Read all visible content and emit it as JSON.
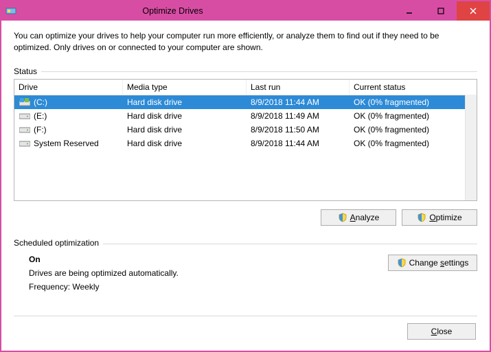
{
  "window": {
    "title": "Optimize Drives"
  },
  "intro": "You can optimize your drives to help your computer run more efficiently, or analyze them to find out if they need to be optimized. Only drives on or connected to your computer are shown.",
  "status_label": "Status",
  "columns": {
    "drive": "Drive",
    "media": "Media type",
    "last": "Last run",
    "status": "Current status"
  },
  "drives": [
    {
      "name": "(C:)",
      "media": "Hard disk drive",
      "last": "8/9/2018 11:44 AM",
      "status": "OK (0% fragmented)",
      "icon": "os-drive",
      "selected": true
    },
    {
      "name": "(E:)",
      "media": "Hard disk drive",
      "last": "8/9/2018 11:49 AM",
      "status": "OK (0% fragmented)",
      "icon": "hdd",
      "selected": false
    },
    {
      "name": "(F:)",
      "media": "Hard disk drive",
      "last": "8/9/2018 11:50 AM",
      "status": "OK (0% fragmented)",
      "icon": "hdd",
      "selected": false
    },
    {
      "name": "System Reserved",
      "media": "Hard disk drive",
      "last": "8/9/2018 11:44 AM",
      "status": "OK (0% fragmented)",
      "icon": "hdd",
      "selected": false
    }
  ],
  "buttons": {
    "analyze_pre": "",
    "analyze_u": "A",
    "analyze_post": "nalyze",
    "optimize_pre": "",
    "optimize_u": "O",
    "optimize_post": "ptimize",
    "change_pre": "Change ",
    "change_u": "s",
    "change_post": "ettings",
    "close_pre": "",
    "close_u": "C",
    "close_post": "lose"
  },
  "sched": {
    "label": "Scheduled optimization",
    "on": "On",
    "desc": "Drives are being optimized automatically.",
    "freq": "Frequency: Weekly"
  }
}
